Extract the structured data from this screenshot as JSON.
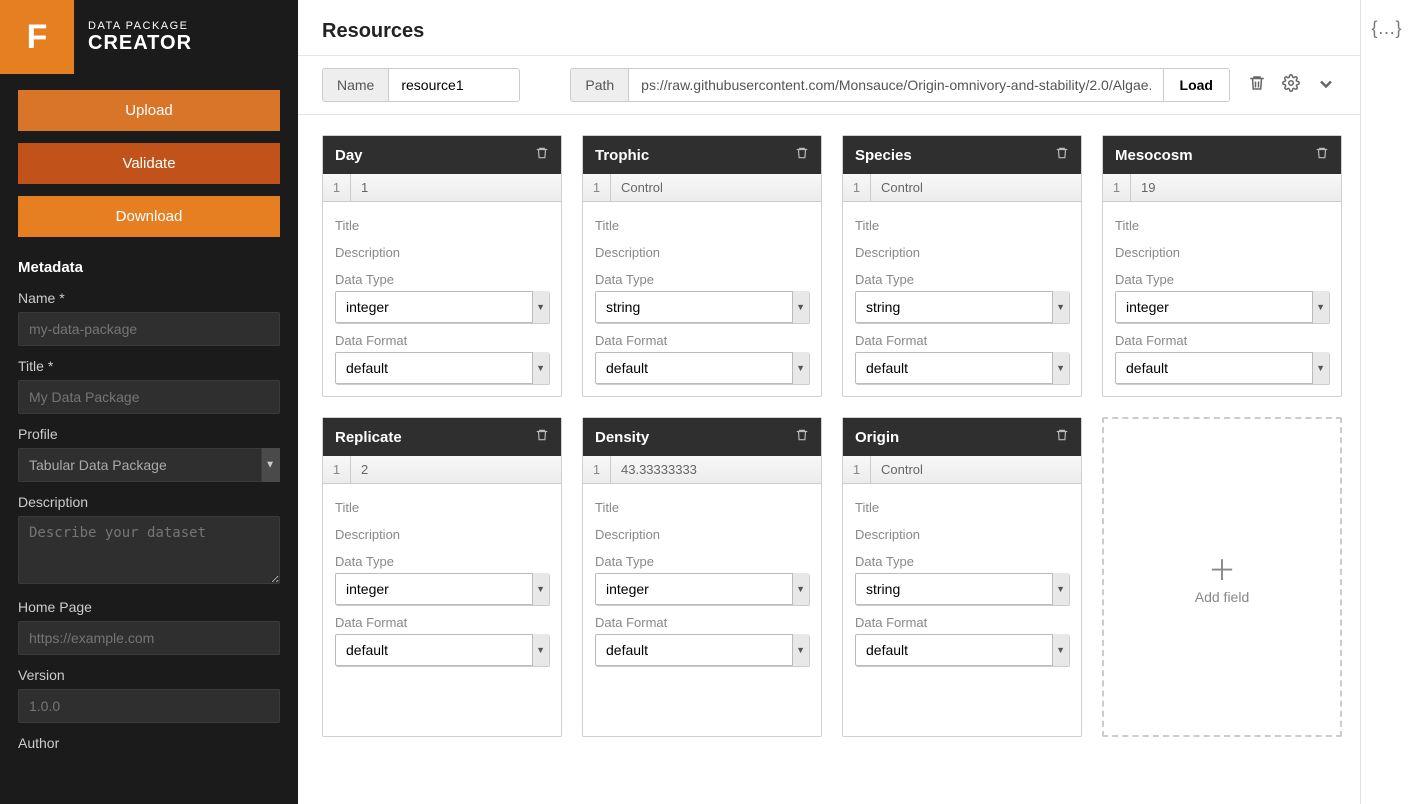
{
  "brand": {
    "logo_letter": "F",
    "line1": "DATA PACKAGE",
    "line2": "CREATOR"
  },
  "sidebar_buttons": {
    "upload": "Upload",
    "validate": "Validate",
    "download": "Download"
  },
  "metadata": {
    "heading": "Metadata",
    "name_label": "Name *",
    "name_placeholder": "my-data-package",
    "title_label": "Title *",
    "title_placeholder": "My Data Package",
    "profile_label": "Profile",
    "profile_value": "Tabular Data Package",
    "description_label": "Description",
    "description_placeholder": "Describe your dataset",
    "homepage_label": "Home Page",
    "homepage_placeholder": "https://example.com",
    "version_label": "Version",
    "version_placeholder": "1.0.0",
    "author_label": "Author"
  },
  "main": {
    "title": "Resources",
    "name_label": "Name",
    "name_value": "resource1",
    "path_label": "Path",
    "path_value": "ps://raw.githubusercontent.com/Monsauce/Origin-omnivory-and-stability/2.0/Algae.csv",
    "load_label": "Load"
  },
  "field_labels": {
    "title": "Title",
    "description": "Description",
    "data_type": "Data Type",
    "data_format": "Data Format"
  },
  "fields": [
    {
      "name": "Day",
      "sample_index": "1",
      "sample_value": "1",
      "data_type": "integer",
      "data_format": "default"
    },
    {
      "name": "Trophic",
      "sample_index": "1",
      "sample_value": "Control",
      "data_type": "string",
      "data_format": "default"
    },
    {
      "name": "Species",
      "sample_index": "1",
      "sample_value": "Control",
      "data_type": "string",
      "data_format": "default"
    },
    {
      "name": "Mesocosm",
      "sample_index": "1",
      "sample_value": "19",
      "data_type": "integer",
      "data_format": "default"
    },
    {
      "name": "Replicate",
      "sample_index": "1",
      "sample_value": "2",
      "data_type": "integer",
      "data_format": "default"
    },
    {
      "name": "Density",
      "sample_index": "1",
      "sample_value": "43.33333333",
      "data_type": "integer",
      "data_format": "default"
    },
    {
      "name": "Origin",
      "sample_index": "1",
      "sample_value": "Control",
      "data_type": "string",
      "data_format": "default"
    }
  ],
  "add_field_label": "Add field",
  "rail_icon": "{…}"
}
